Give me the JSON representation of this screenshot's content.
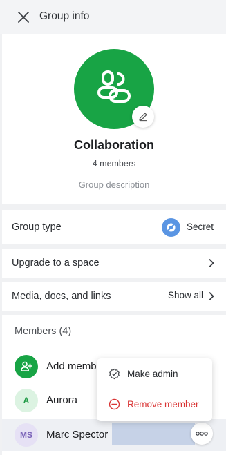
{
  "header": {
    "title": "Group info",
    "close_icon": "close-icon"
  },
  "profile": {
    "name": "Collaboration",
    "member_count": "4 members",
    "description_placeholder": "Group description",
    "avatar_color": "#18a445",
    "avatar_icon": "group-icon",
    "edit_icon": "pencil-icon"
  },
  "group_type": {
    "label": "Group type",
    "value": "Secret",
    "icon": "secret-icon",
    "icon_color": "#5a95e3"
  },
  "upgrade": {
    "label": "Upgrade to a space",
    "icon": "chevron-right-icon"
  },
  "media": {
    "label": "Media, docs, and links",
    "action": "Show all",
    "icon": "chevron-right-icon"
  },
  "members": {
    "title": "Members (4)",
    "add_label": "Add member",
    "items": [
      {
        "initials": "A",
        "name": "Aurora",
        "avatar_bg": "#dcf3e2",
        "avatar_fg": "#1f9a45"
      },
      {
        "initials": "MS",
        "name": "Marc Spector",
        "avatar_bg": "#e6e1f5",
        "avatar_fg": "#7a63b8"
      }
    ],
    "more_icon": "more-horizontal-icon"
  },
  "context_menu": {
    "items": [
      {
        "label": "Make admin",
        "icon": "badge-check-icon"
      },
      {
        "label": "Remove member",
        "icon": "minus-circle-icon",
        "color": "#d93535"
      }
    ]
  }
}
